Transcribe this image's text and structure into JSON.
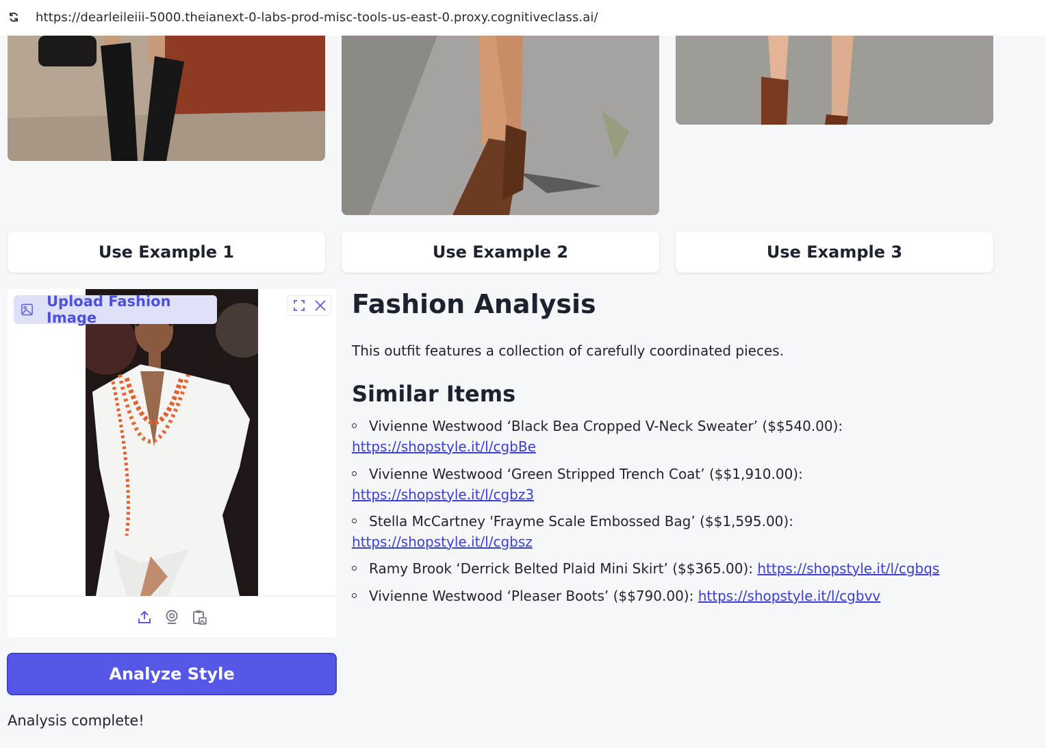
{
  "browser": {
    "url": "https://dearleileiii-5000.theianext-0-labs-prod-misc-tools-us-east-0.proxy.cognitiveclass.ai/"
  },
  "examples": {
    "buttons": [
      "Use Example 1",
      "Use Example 2",
      "Use Example 3"
    ]
  },
  "upload": {
    "label": "Upload Fashion Image"
  },
  "actions": {
    "analyze_label": "Analyze Style",
    "status": "Analysis complete!"
  },
  "results": {
    "title": "Fashion Analysis",
    "description": "This outfit features a collection of carefully coordinated pieces.",
    "similar_title": "Similar Items",
    "items": [
      {
        "text": "Vivienne Westwood ‘Black Bea Cropped V-Neck Sweater’ ($$540.00):",
        "link": "https://shopstyle.it/l/cgbBe"
      },
      {
        "text": "Vivienne Westwood ‘Green Stripped Trench Coat’ ($$1,910.00):",
        "link": "https://shopstyle.it/l/cgbz3"
      },
      {
        "text": "Stella McCartney 'Frayme Scale Embossed Bag’ ($$1,595.00):",
        "link": "https://shopstyle.it/l/cgbsz"
      },
      {
        "text": "Ramy Brook ‘Derrick Belted Plaid Mini Skirt’ ($$365.00):",
        "link": "https://shopstyle.it/l/cgbqs"
      },
      {
        "text": "Vivienne Westwood ‘Pleaser Boots’ ($$790.00):",
        "link": "https://shopstyle.it/l/cgbvv"
      }
    ]
  },
  "colors": {
    "accent": "#5558e6",
    "link": "#3b3fd1",
    "background": "#f6f7f9"
  }
}
